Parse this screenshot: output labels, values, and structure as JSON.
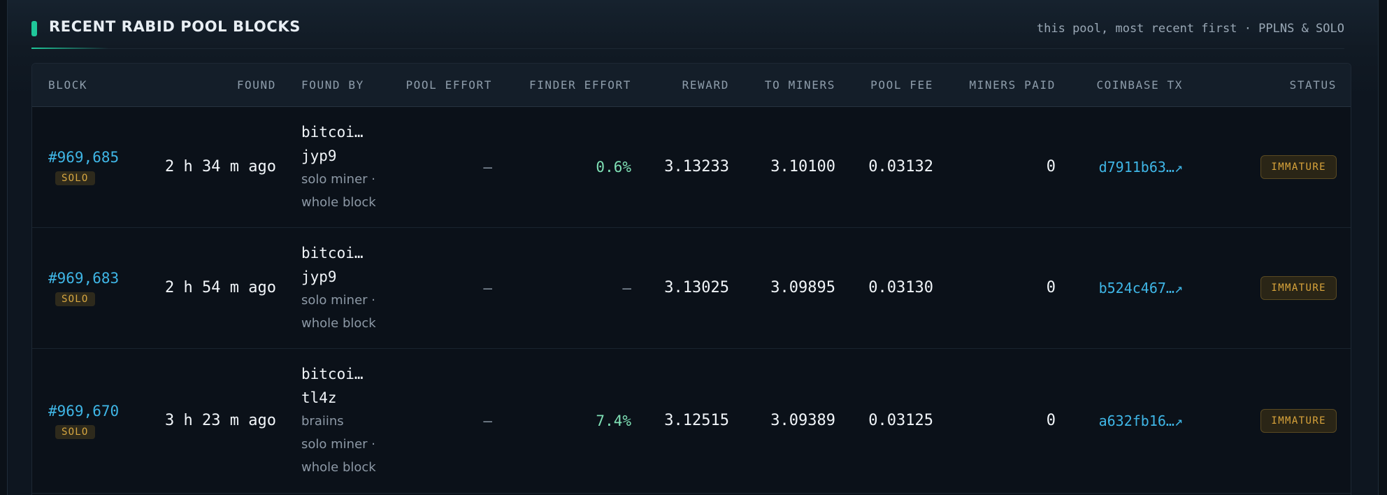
{
  "section": {
    "title": "RECENT RABID POOL BLOCKS",
    "subtitle": "this pool, most recent first · PPLNS & SOLO",
    "accent_color": "#1fc79a"
  },
  "table": {
    "columns": [
      "BLOCK",
      "FOUND",
      "FOUND BY",
      "POOL EFFORT",
      "FINDER EFFORT",
      "REWARD",
      "TO MINERS",
      "POOL FEE",
      "MINERS PAID",
      "COINBASE TX",
      "STATUS"
    ],
    "rows": [
      {
        "block": "#969,685",
        "mode": "SOLO",
        "found": "2 h 34 m ago",
        "finder_line1": "bitcoi…",
        "finder_line2": "jyp9",
        "finder_lines": [
          "solo miner ·",
          "whole block"
        ],
        "pool_effort": "—",
        "finder_effort": "0.6%",
        "reward": "3.13233",
        "to_miners": "3.10100",
        "pool_fee": "0.03132",
        "miners_paid": "0",
        "coinbase_tx": "d7911b63…↗",
        "status": "IMMATURE"
      },
      {
        "block": "#969,683",
        "mode": "SOLO",
        "found": "2 h 54 m ago",
        "finder_line1": "bitcoi…",
        "finder_line2": "jyp9",
        "finder_lines": [
          "solo miner ·",
          "whole block"
        ],
        "pool_effort": "—",
        "finder_effort": "—",
        "reward": "3.13025",
        "to_miners": "3.09895",
        "pool_fee": "0.03130",
        "miners_paid": "0",
        "coinbase_tx": "b524c467…↗",
        "status": "IMMATURE"
      },
      {
        "block": "#969,670",
        "mode": "SOLO",
        "found": "3 h 23 m ago",
        "finder_line1": "bitcoi…",
        "finder_line2": "tl4z",
        "finder_lines": [
          "braiins",
          "solo miner ·",
          "whole block"
        ],
        "pool_effort": "—",
        "finder_effort": "7.4%",
        "reward": "3.12515",
        "to_miners": "3.09389",
        "pool_fee": "0.03125",
        "miners_paid": "0",
        "coinbase_tx": "a632fb16…↗",
        "status": "IMMATURE"
      }
    ]
  }
}
